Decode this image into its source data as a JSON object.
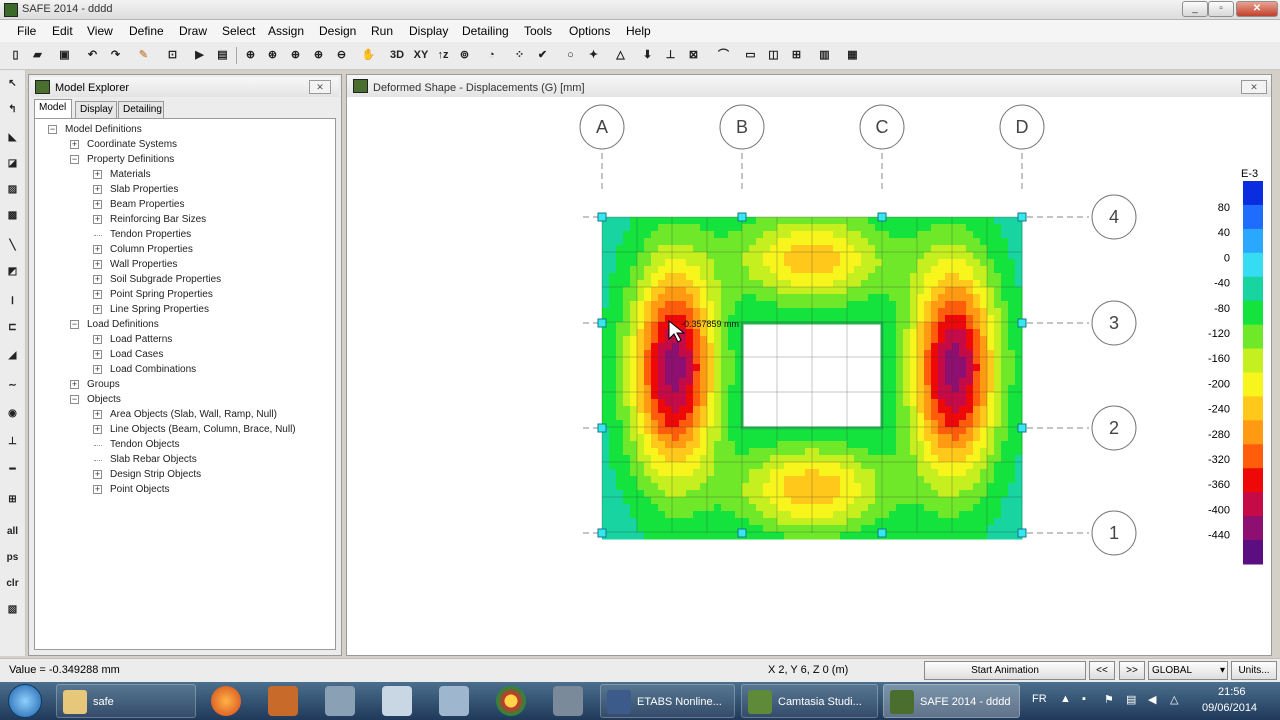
{
  "window": {
    "title": "SAFE 2014 - dddd",
    "min": "_",
    "max": "▫",
    "close": "✕"
  },
  "menu": [
    "File",
    "Edit",
    "View",
    "Define",
    "Draw",
    "Select",
    "Assign",
    "Design",
    "Run",
    "Display",
    "Detailing",
    "Tools",
    "Options",
    "Help"
  ],
  "toolbar": {
    "btn_3d": "3D",
    "btn_xy": "XY",
    "btn_xz": "↑z"
  },
  "left_tools": {
    "all": "all",
    "ps": "ps",
    "clr": "clr"
  },
  "explorer": {
    "title": "Model Explorer",
    "tabs": [
      "Model",
      "Display",
      "Detailing"
    ],
    "tree": [
      {
        "label": "Model Definitions",
        "level": 0,
        "expander": "−"
      },
      {
        "label": "Coordinate Systems",
        "level": 1,
        "expander": "+"
      },
      {
        "label": "Property Definitions",
        "level": 1,
        "expander": "−"
      },
      {
        "label": "Materials",
        "level": 2,
        "expander": "+"
      },
      {
        "label": "Slab Properties",
        "level": 2,
        "expander": "+"
      },
      {
        "label": "Beam Properties",
        "level": 2,
        "expander": "+"
      },
      {
        "label": "Reinforcing Bar Sizes",
        "level": 2,
        "expander": "+"
      },
      {
        "label": "Tendon Properties",
        "level": 2,
        "expander": ""
      },
      {
        "label": "Column Properties",
        "level": 2,
        "expander": "+"
      },
      {
        "label": "Wall Properties",
        "level": 2,
        "expander": "+"
      },
      {
        "label": "Soil Subgrade Properties",
        "level": 2,
        "expander": "+"
      },
      {
        "label": "Point Spring Properties",
        "level": 2,
        "expander": "+"
      },
      {
        "label": "Line Spring Properties",
        "level": 2,
        "expander": "+"
      },
      {
        "label": "Load Definitions",
        "level": 1,
        "expander": "−"
      },
      {
        "label": "Load Patterns",
        "level": 2,
        "expander": "+"
      },
      {
        "label": "Load Cases",
        "level": 2,
        "expander": "+"
      },
      {
        "label": "Load Combinations",
        "level": 2,
        "expander": "+"
      },
      {
        "label": "Groups",
        "level": 1,
        "expander": "+"
      },
      {
        "label": "Objects",
        "level": 1,
        "expander": "−"
      },
      {
        "label": "Area Objects (Slab, Wall, Ramp, Null)",
        "level": 2,
        "expander": "+"
      },
      {
        "label": "Line Objects (Beam, Column, Brace, Null)",
        "level": 2,
        "expander": "+"
      },
      {
        "label": "Tendon Objects",
        "level": 2,
        "expander": ""
      },
      {
        "label": "Slab Rebar Objects",
        "level": 2,
        "expander": ""
      },
      {
        "label": "Design Strip Objects",
        "level": 2,
        "expander": "+"
      },
      {
        "label": "Point Objects",
        "level": 2,
        "expander": "+"
      }
    ]
  },
  "viewport": {
    "title": "Deformed Shape - Displacements (G)  [mm]",
    "grid_columns": [
      "A",
      "B",
      "C",
      "D"
    ],
    "grid_rows": [
      "4",
      "3",
      "2",
      "1"
    ],
    "probe_value": "-0.357859 mm",
    "legend": {
      "unit": "E-3",
      "labels": [
        "80",
        "40",
        "0",
        "-40",
        "-80",
        "-120",
        "-160",
        "-200",
        "-240",
        "-280",
        "-320",
        "-360",
        "-400",
        "-440"
      ],
      "colors": [
        "#0b2de0",
        "#1f6dff",
        "#2aa8ff",
        "#36dcf2",
        "#18d4a0",
        "#14e33e",
        "#6fe82a",
        "#c6ef1f",
        "#f8f51c",
        "#ffc81a",
        "#ff9a12",
        "#ff5c0c",
        "#ee0808",
        "#c40b48",
        "#8e0f72",
        "#5a0e82"
      ]
    }
  },
  "status": {
    "value_text": "Value = -0.349288 mm",
    "coords": "X 2,  Y 6,  Z 0  (m)",
    "start_animation": "Start Animation",
    "prev": "<<",
    "next": ">>",
    "coord_system": "GLOBAL",
    "units": "Units..."
  },
  "taskbar": {
    "tasks": [
      {
        "label": "safe"
      },
      {
        "label": "ETABS Nonline..."
      },
      {
        "label": "Camtasia Studi..."
      },
      {
        "label": "SAFE 2014 - dddd"
      }
    ],
    "lang": "FR",
    "time": "21:56",
    "date": "09/06/2014"
  }
}
